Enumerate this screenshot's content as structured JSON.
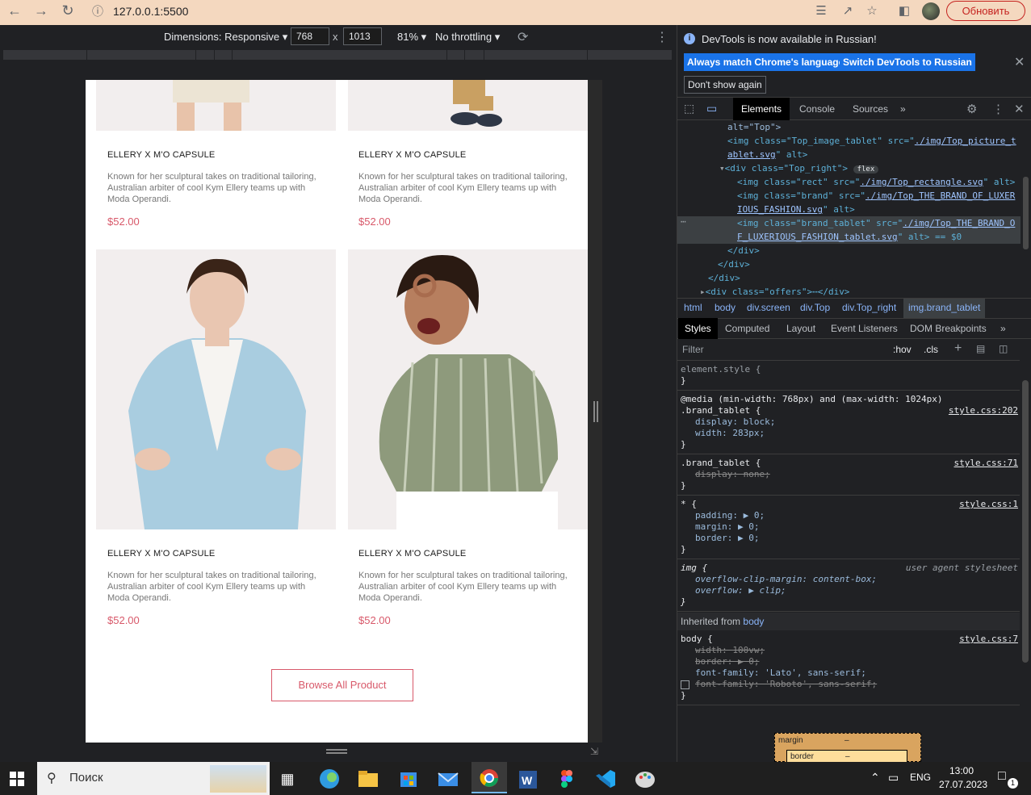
{
  "browser": {
    "url": "127.0.0.1:5500",
    "update_label": "Обновить"
  },
  "device_toolbar": {
    "dimensions_label": "Dimensions: Responsive",
    "width": "768",
    "times": "x",
    "height": "1013",
    "zoom": "81%",
    "throttling": "No throttling"
  },
  "page": {
    "cards": [
      {
        "title": "ELLERY X M'O CAPSULE",
        "text": "Known for her sculptural takes on traditional tailoring, Australian arbiter of cool Kym Ellery teams up with Moda Operandi.",
        "price": "$52.00"
      },
      {
        "title": "ELLERY X M'O CAPSULE",
        "text": "Known for her sculptural takes on traditional tailoring, Australian arbiter of cool Kym Ellery teams up with Moda Operandi.",
        "price": "$52.00"
      },
      {
        "title": "ELLERY X M'O CAPSULE",
        "text": "Known for her sculptural takes on traditional tailoring, Australian arbiter of cool Kym Ellery teams up with Moda Operandi.",
        "price": "$52.00"
      },
      {
        "title": "ELLERY X M'O CAPSULE",
        "text": "Known for her sculptural takes on traditional tailoring, Australian arbiter of cool Kym Ellery teams up with Moda Operandi.",
        "price": "$52.00"
      }
    ],
    "browse_button": "Browse All Product"
  },
  "devtools": {
    "notice_text": "DevTools is now available in Russian!",
    "match_language": "Always match Chrome's language",
    "switch_russian": "Switch DevTools to Russian",
    "dont_show": "Don't show again",
    "tabs": [
      "Elements",
      "Console",
      "Sources"
    ],
    "tree": {
      "l0": "alt=\"Top\">",
      "l1_tag": "<img class=\"Top_image_tablet\" src=\"",
      "l1_link": "./img/Top_picture_t",
      "l2_link": "ablet.svg",
      "l2_rest": "\" alt>",
      "l3_tag": "<div class=\"Top_right\">",
      "l3_badge": "flex",
      "l4_tag": "<img class=\"rect\" src=\"",
      "l4_link": "./img/Top_rectangle.svg",
      "l4_rest": "\" alt>",
      "l5_tag": "<img class=\"brand\" src=\"",
      "l5_link": "./img/Top_THE_BRAND_OF_LUXER",
      "l6_link": "IOUS_FASHION.svg",
      "l6_rest": "\" alt>",
      "l7_tag": "<img class=\"brand_tablet\" src=\"",
      "l7_link": "./img/Top_THE_BRAND_O",
      "l8_link": "F_LUXERIOUS_FASHION_tablet.svg",
      "l8_rest": "\" alt> == $0",
      "l9": "</div>",
      "l10": "</div>",
      "l11": "</div>",
      "l12": "<div class=\"offers\">⋯</div>"
    },
    "breadcrumb": [
      "html",
      "body",
      "div.screen",
      "div.Top",
      "div.Top_right",
      "img.brand_tablet"
    ],
    "sub_tabs": [
      "Styles",
      "Computed",
      "Layout",
      "Event Listeners",
      "DOM Breakpoints"
    ],
    "filter_placeholder": "Filter",
    "hov": ":hov",
    "cls": ".cls",
    "styles": {
      "element_style": "element.style {",
      "close": "}",
      "media": "@media (min-width: 768px) and (max-width: 1024px)",
      "r1_sel": ".brand_tablet {",
      "r1_src": "style.css:202",
      "r1_p1": "display: block;",
      "r1_p2": "width: 283px;",
      "r2_sel": ".brand_tablet {",
      "r2_src": "style.css:71",
      "r2_p1": "display: none;",
      "r3_sel": "* {",
      "r3_src": "style.css:1",
      "r3_p1": "padding: ▶ 0;",
      "r3_p2": "margin: ▶ 0;",
      "r3_p3": "border: ▶ 0;",
      "r4_sel": "img {",
      "r4_src": "user agent stylesheet",
      "r4_p1": "overflow-clip-margin: content-box;",
      "r4_p2": "overflow: ▶ clip;",
      "inherited": "Inherited from",
      "inherited_from": "body",
      "r5_sel": "body {",
      "r5_src": "style.css:7",
      "r5_p1": "width: 100vw;",
      "r5_p2": "border: ▶ 0;",
      "r5_p3": "font-family: 'Lato', sans-serif;",
      "r5_p4": "font-family: 'Roboto', sans-serif;"
    },
    "box_margin": "margin",
    "box_border": "border",
    "box_dash": "–"
  },
  "taskbar": {
    "search": "Поиск",
    "lang": "ENG",
    "time": "13:00",
    "date": "27.07.2023",
    "notif_count": "1"
  },
  "colors": {
    "accent": "#d8596a",
    "devtools_bg": "#202124",
    "chrome_bar": "#f4d8bf"
  }
}
